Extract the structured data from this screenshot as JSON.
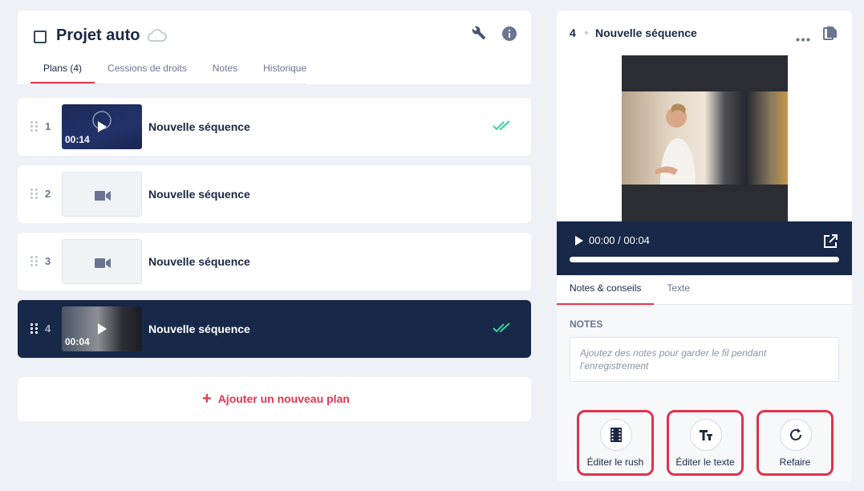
{
  "project": {
    "title": "Projet auto"
  },
  "tabs": [
    {
      "label": "Plans (4)",
      "active": true
    },
    {
      "label": "Cessions de droits",
      "active": false
    },
    {
      "label": "Notes",
      "active": false
    },
    {
      "label": "Historique",
      "active": false
    }
  ],
  "plans": [
    {
      "number": "1",
      "title": "Nouvelle séquence",
      "duration": "00:14",
      "has_video": true,
      "validated": true,
      "selected": false
    },
    {
      "number": "2",
      "title": "Nouvelle séquence",
      "duration": "",
      "has_video": false,
      "validated": false,
      "selected": false
    },
    {
      "number": "3",
      "title": "Nouvelle séquence",
      "duration": "",
      "has_video": false,
      "validated": false,
      "selected": false
    },
    {
      "number": "4",
      "title": "Nouvelle séquence",
      "duration": "00:04",
      "has_video": true,
      "validated": true,
      "selected": true
    }
  ],
  "add_plan_label": "Ajouter un nouveau plan",
  "detail": {
    "number": "4",
    "title": "Nouvelle séquence",
    "player_time": "00:00 / 00:04",
    "tabs": [
      {
        "label": "Notes & conseils",
        "active": true
      },
      {
        "label": "Texte",
        "active": false
      }
    ],
    "notes_label": "NOTES",
    "notes_placeholder": "Ajoutez des notes pour garder le fil pendant l’enregistrement",
    "actions": [
      {
        "label": "Éditer le rush",
        "icon": "film-icon"
      },
      {
        "label": "Éditer le texte",
        "icon": "text-icon"
      },
      {
        "label": "Refaire",
        "icon": "redo-icon"
      }
    ]
  },
  "colors": {
    "accent": "#e8344e",
    "navy": "#172848",
    "check": "#3ccfa2"
  }
}
